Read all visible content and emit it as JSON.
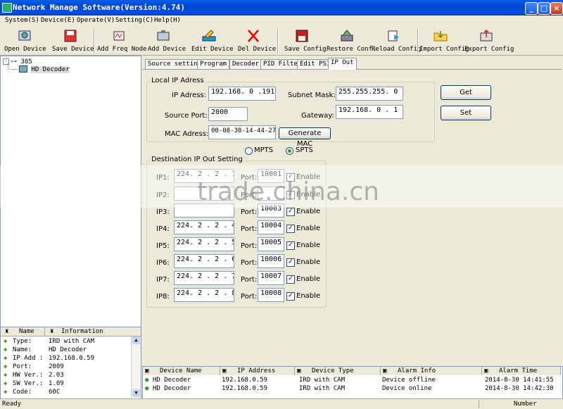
{
  "window": {
    "title": "Network Manage Software(Version:4.74)"
  },
  "menu": [
    "System(S)",
    "Device(E)",
    "Operate(V)",
    "Setting(C)",
    "Help(H)"
  ],
  "toolbar": {
    "open_device": "Open Device",
    "save_device": "Save Device",
    "add_freq_node": "Add Freq Node",
    "add_device": "Add Device",
    "edit_device": "Edit Device",
    "del_device": "Del Device",
    "save_config": "Save Config",
    "restore_conf": "Restore Conf.",
    "reload_config": "Reload Config",
    "import_config": "Import Config",
    "export_config": "Export Config"
  },
  "tree": {
    "root": "385",
    "child": "HD Decoder"
  },
  "props": {
    "col_name": "Name",
    "col_info": "Information",
    "rows": [
      {
        "k": "Type:",
        "v": "IRD with CAM"
      },
      {
        "k": "Name:",
        "v": "HD Decoder"
      },
      {
        "k": "IP Add :",
        "v": "192.168.0.59"
      },
      {
        "k": "Port:",
        "v": "2009"
      },
      {
        "k": "HW Ver.:",
        "v": "2.03"
      },
      {
        "k": "SW Ver.:",
        "v": "1.09"
      },
      {
        "k": "Code:",
        "v": "60C"
      }
    ]
  },
  "tabs": [
    "Source setting",
    "Program",
    "Decoder",
    "PID Filter",
    "Edit PSI",
    "IP Out"
  ],
  "local": {
    "title": "Local IP Adress",
    "ip_label": "IP Adress:",
    "ip_value": "192.168. 0 .191",
    "mask_label": "Subnet Mask:",
    "mask_value": "255.255.255. 0",
    "port_label": "Source Port:",
    "port_value": "2000",
    "gw_label": "Gateway:",
    "gw_value": "192.168. 0 . 1",
    "mac_label": "MAC Adress:",
    "mac_value": "00-08-30-14-44-27",
    "gen_mac": "Generate MAC"
  },
  "buttons": {
    "get": "Get",
    "set": "Set"
  },
  "mode": {
    "mpts": "MPTS",
    "spts": "SPTS"
  },
  "dest": {
    "title": "Destination IP Out Setting",
    "port_label": "Port:",
    "enable_label": "Enable",
    "rows": [
      {
        "label": "IP1:",
        "ip": "224. 2 . 2 . 1",
        "port": "10001"
      },
      {
        "label": "IP2:",
        "ip": "",
        "port": ""
      },
      {
        "label": "IP3:",
        "ip": "",
        "port": "10003"
      },
      {
        "label": "IP4:",
        "ip": "224. 2 . 2 . 4",
        "port": "10004"
      },
      {
        "label": "IP5:",
        "ip": "224. 2 . 2 . 5",
        "port": "10005"
      },
      {
        "label": "IP6:",
        "ip": "224. 2 . 2 . 6",
        "port": "10006"
      },
      {
        "label": "IP7:",
        "ip": "224. 2 . 2 . 7",
        "port": "10007"
      },
      {
        "label": "IP8:",
        "ip": "224. 2 . 2 . 8",
        "port": "10008"
      }
    ]
  },
  "watermark": "trade.china.cn",
  "alarm": {
    "cols": [
      "Device Name",
      "IP Address",
      "Device Type",
      "Alarm Info",
      "Alarm Time"
    ],
    "rows": [
      [
        "HD Decoder",
        "192.168.0.59",
        "IRD with CAM",
        "Device offline",
        "2014-8-30 14:41:55"
      ],
      [
        "HD Decoder",
        "192.168.0.59",
        "IRD with CAM",
        "Device online",
        "2014-8-30 14:42:30"
      ]
    ]
  },
  "status": {
    "left": "Ready",
    "right": "Number"
  }
}
